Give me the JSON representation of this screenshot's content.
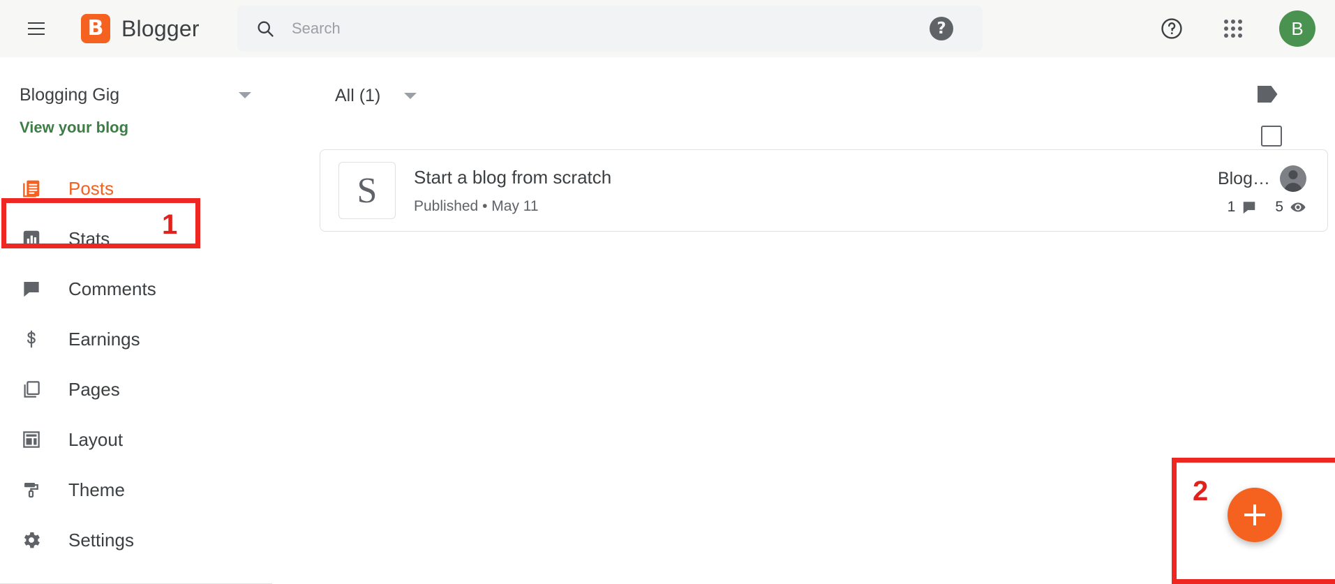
{
  "header": {
    "menu_icon": "hamburger-menu-icon",
    "brand_logo_letter": "B",
    "brand_name": "Blogger",
    "search": {
      "icon": "search-icon",
      "placeholder": "Search",
      "value": "",
      "help_badge": "?"
    },
    "help_icon": "help-circle-outline-icon",
    "apps_icon": "apps-grid-icon",
    "avatar_letter": "B",
    "avatar_color": "#4a9250",
    "background": "#f7f7f5"
  },
  "sidebar": {
    "blog_title": "Blogging Gig",
    "blog_switch_icon": "chevron-down-icon",
    "view_blog_label": "View your blog",
    "view_blog_color": "#3f7d47",
    "active_color": "#f5621f",
    "items": [
      {
        "label": "Posts",
        "icon": "posts-icon",
        "active": true
      },
      {
        "label": "Stats",
        "icon": "stats-icon",
        "active": false
      },
      {
        "label": "Comments",
        "icon": "comments-icon",
        "active": false
      },
      {
        "label": "Earnings",
        "icon": "earnings-icon",
        "active": false
      },
      {
        "label": "Pages",
        "icon": "pages-icon",
        "active": false
      },
      {
        "label": "Layout",
        "icon": "layout-icon",
        "active": false
      },
      {
        "label": "Theme",
        "icon": "theme-icon",
        "active": false
      },
      {
        "label": "Settings",
        "icon": "settings-icon",
        "active": false
      }
    ]
  },
  "main": {
    "toolbar": {
      "filter_label": "All (1)",
      "filter_caret_icon": "chevron-down-icon",
      "label_icon": "tag-label-icon",
      "select_all_checked": false
    },
    "posts": [
      {
        "thumb_letter": "S",
        "title": "Start a blog from scratch",
        "status": "Published",
        "separator": "•",
        "date": "May 11",
        "author_label": "Blog…",
        "author_avatar": "person-avatar-icon",
        "comments_count": "1",
        "comments_icon": "comment-icon",
        "views_count": "5",
        "views_icon": "eye-icon"
      }
    ],
    "fab": {
      "icon": "plus-icon",
      "color": "#f5621f"
    }
  },
  "annotations": {
    "color": "#ee2722",
    "markers": [
      {
        "number": "1",
        "target": "sidebar-item-posts"
      },
      {
        "number": "2",
        "target": "new-post-fab"
      }
    ]
  }
}
